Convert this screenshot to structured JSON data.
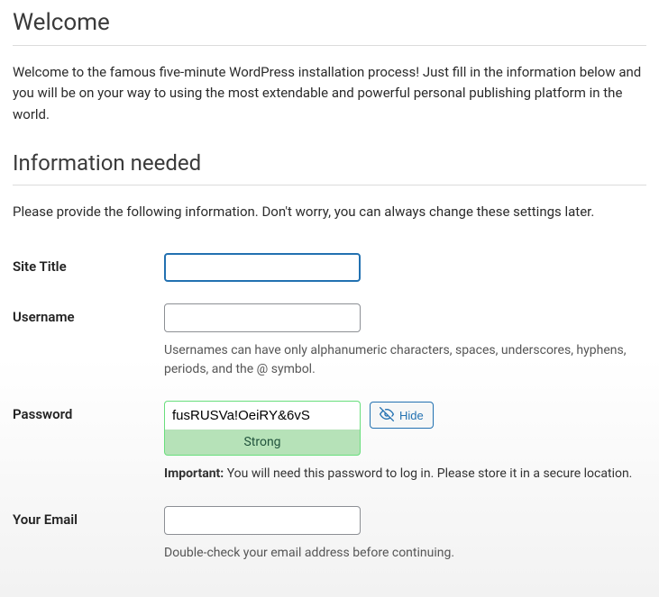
{
  "welcome": {
    "heading": "Welcome",
    "intro": "Welcome to the famous five-minute WordPress installation process! Just fill in the information below and you will be on your way to using the most extendable and powerful personal publishing platform in the world."
  },
  "info": {
    "heading": "Information needed",
    "intro": "Please provide the following information. Don't worry, you can always change these settings later."
  },
  "form": {
    "siteTitle": {
      "label": "Site Title",
      "value": ""
    },
    "username": {
      "label": "Username",
      "value": "",
      "hint": "Usernames can have only alphanumeric characters, spaces, underscores, hyphens, periods, and the @ symbol."
    },
    "password": {
      "label": "Password",
      "value": "fusRUSVa!OeiRY&6vS",
      "strength": "Strong",
      "hideLabel": "Hide",
      "importantLabel": "Important:",
      "importantText": " You will need this password to log in. Please store it in a secure location."
    },
    "email": {
      "label": "Your Email",
      "value": "",
      "hint": "Double-check your email address before continuing."
    }
  }
}
